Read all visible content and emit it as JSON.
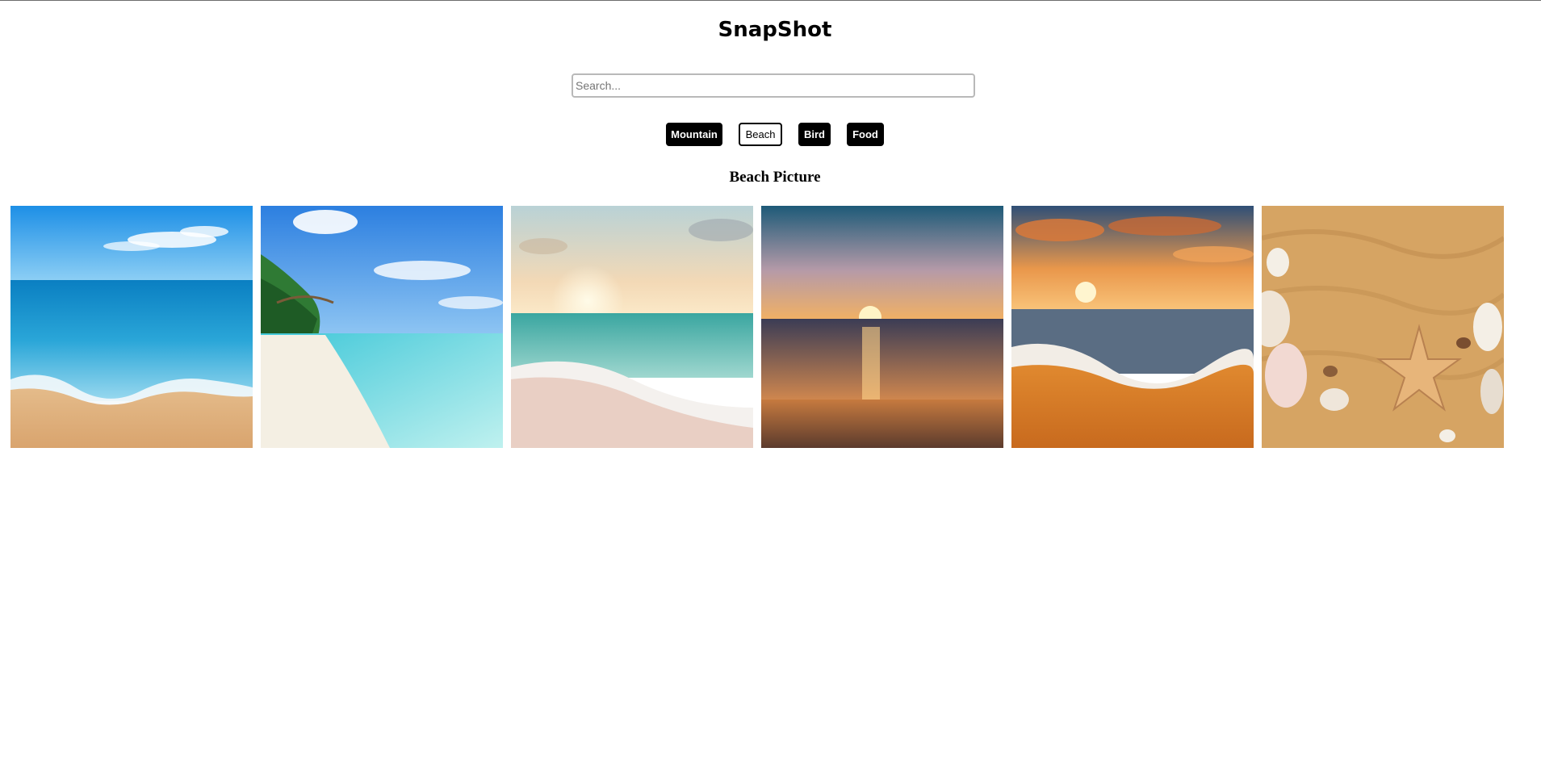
{
  "app": {
    "title": "SnapShot"
  },
  "search": {
    "placeholder": "Search...",
    "value": ""
  },
  "filters": [
    {
      "label": "Mountain",
      "active": false
    },
    {
      "label": "Beach",
      "active": true
    },
    {
      "label": "Bird",
      "active": false
    },
    {
      "label": "Food",
      "active": false
    }
  ],
  "gallery": {
    "heading": "Beach Picture",
    "photos": [
      {
        "subject": "turquoise-waves-on-sand"
      },
      {
        "subject": "tropical-palm-beach"
      },
      {
        "subject": "pastel-sunrise-shore"
      },
      {
        "subject": "sunset-over-sea"
      },
      {
        "subject": "orange-sunset-waves"
      },
      {
        "subject": "sand-with-seashells-and-starfish"
      }
    ]
  },
  "colors": {
    "text": "#000000",
    "button_bg": "#000000",
    "button_text": "#ffffff",
    "active_bg": "#ffffff"
  }
}
